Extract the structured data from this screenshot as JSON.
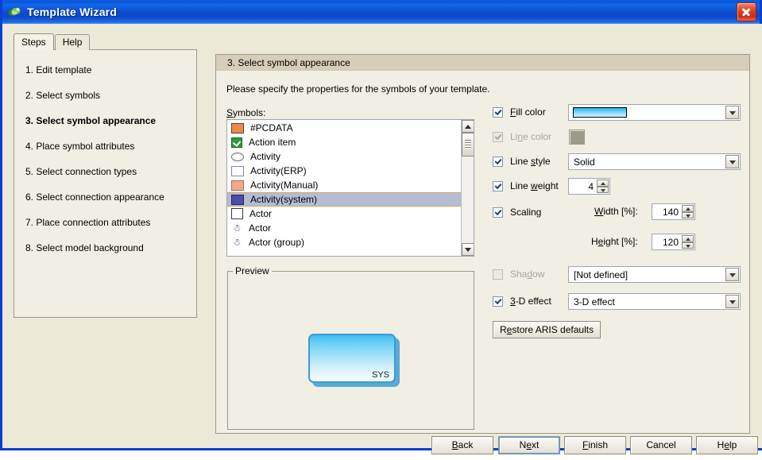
{
  "window": {
    "title": "Template Wizard",
    "icon": "app-icon",
    "close_label": "×"
  },
  "left_tabs": [
    {
      "label": "Steps",
      "active": true
    },
    {
      "label": "Help",
      "active": false
    }
  ],
  "steps": [
    {
      "label": "1. Edit template",
      "current": false
    },
    {
      "label": "2. Select symbols",
      "current": false
    },
    {
      "label": "3. Select symbol appearance",
      "current": true
    },
    {
      "label": "4. Place symbol attributes",
      "current": false
    },
    {
      "label": "5. Select connection types",
      "current": false
    },
    {
      "label": "6. Select connection appearance",
      "current": false
    },
    {
      "label": "7. Place connection attributes",
      "current": false
    },
    {
      "label": "8. Select model background",
      "current": false
    }
  ],
  "main": {
    "section_header": "3. Select symbol appearance",
    "intro": "Please specify the properties for the symbols of your template.",
    "symbols_label": "Symbols:",
    "preview_legend": "Preview",
    "preview_symbol_text": "SYS"
  },
  "symbols": [
    {
      "label": "#PCDATA",
      "icon": "rect-orange",
      "selected": false
    },
    {
      "label": "Action item",
      "icon": "rect-green-check",
      "selected": false
    },
    {
      "label": "Activity",
      "icon": "ellipse",
      "selected": false
    },
    {
      "label": "Activity(ERP)",
      "icon": "rect-blue-outline",
      "selected": false
    },
    {
      "label": "Activity(Manual)",
      "icon": "rect-salmon",
      "selected": false
    },
    {
      "label": "Activity(system)",
      "icon": "rect-darkblue",
      "selected": true
    },
    {
      "label": "Actor",
      "icon": "rect-white",
      "selected": false
    },
    {
      "label": "Actor",
      "icon": "person",
      "selected": false
    },
    {
      "label": "Actor (group)",
      "icon": "person",
      "selected": false
    }
  ],
  "properties": {
    "fill_color": {
      "label": "Fill color",
      "checked": true,
      "enabled": true,
      "swatch_color": "#8ed9f8"
    },
    "line_color": {
      "label": "Line color",
      "checked": true,
      "enabled": false,
      "swatch_color": "#9b9b8a"
    },
    "line_style": {
      "label": "Line style",
      "checked": true,
      "enabled": true,
      "value": "Solid"
    },
    "line_weight": {
      "label": "Line weight",
      "checked": true,
      "enabled": true,
      "value": "4"
    },
    "scaling": {
      "label": "Scaling",
      "checked": true,
      "enabled": true,
      "width_label": "Width [%]:",
      "width_value": "140",
      "height_label": "Height [%]:",
      "height_value": "120"
    },
    "shadow": {
      "label": "Shadow",
      "checked": false,
      "enabled": false,
      "value": "[Not defined]"
    },
    "three_d": {
      "label": "3-D effect",
      "checked": true,
      "enabled": true,
      "value": "3-D effect"
    },
    "restore_label": "Restore ARIS defaults"
  },
  "buttons": [
    {
      "label": "Back",
      "default": false
    },
    {
      "label": "Next",
      "default": true
    },
    {
      "label": "Finish",
      "default": false
    },
    {
      "label": "Cancel",
      "default": false
    },
    {
      "label": "Help",
      "default": false
    }
  ],
  "colors": {
    "titlebar_blue": "#0d4fd0",
    "window_border": "#0A3FD4",
    "panel_bg": "#f1eee3",
    "dialog_bg": "#ece9d8",
    "header_bg": "#d6cdba",
    "selection_bg": "#b4bdd6",
    "selection_border": "#d9a24c"
  }
}
